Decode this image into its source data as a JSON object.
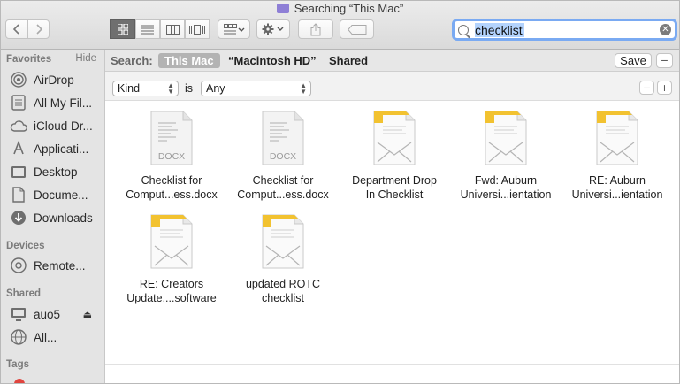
{
  "window": {
    "title": "Searching “This Mac”"
  },
  "search": {
    "query": "checklist"
  },
  "sidebar": {
    "favorites_header": "Favorites",
    "hide_label": "Hide",
    "favorites": [
      "AirDrop",
      "All My Fil...",
      "iCloud Dr...",
      "Applicati...",
      "Desktop",
      "Docume...",
      "Downloads"
    ],
    "devices_header": "Devices",
    "devices": [
      "Remote..."
    ],
    "shared_header": "Shared",
    "shared": [
      "auo5",
      "All..."
    ],
    "tags_header": "Tags"
  },
  "scope": {
    "label": "Search:",
    "options": [
      "This Mac",
      "“Macintosh HD”",
      "Shared"
    ],
    "save_label": "Save"
  },
  "criteria": {
    "attribute": "Kind",
    "operator": "is",
    "value": "Any"
  },
  "files": [
    {
      "line1": "Checklist for",
      "line2": "Comput...ess.docx",
      "type": "DOCX"
    },
    {
      "line1": "Checklist for",
      "line2": "Comput...ess.docx",
      "type": "DOCX"
    },
    {
      "line1": "Department Drop",
      "line2": "In Checklist",
      "type": "email"
    },
    {
      "line1": "Fwd: Auburn",
      "line2": "Universi...ientation",
      "type": "email"
    },
    {
      "line1": "RE: Auburn",
      "line2": "Universi...ientation",
      "type": "email"
    },
    {
      "line1": "RE: Creators",
      "line2": "Update,...software",
      "type": "email"
    },
    {
      "line1": "updated ROTC",
      "line2": "checklist",
      "type": "email"
    }
  ],
  "colors": {
    "accent_focus": "#7aaaf2",
    "scope_active": "#b3b3b3",
    "email_badge": "#f2c230"
  }
}
